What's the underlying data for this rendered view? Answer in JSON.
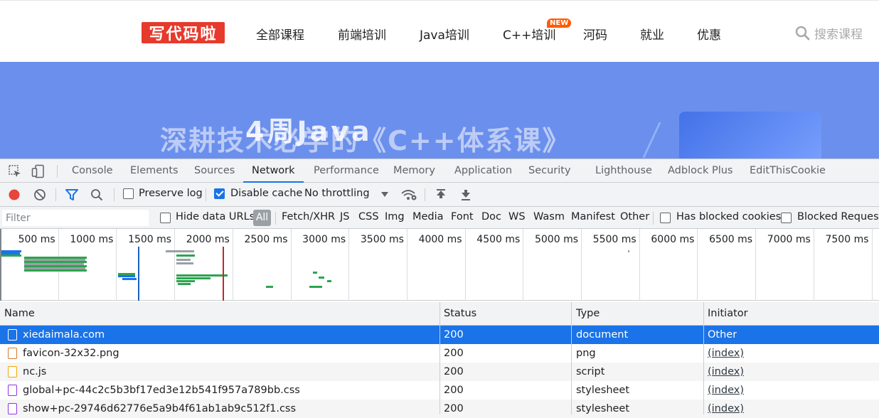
{
  "site": {
    "logo_text": "写代码啦",
    "nav": [
      "全部课程",
      "前端培训",
      "Java培训",
      "C++培训",
      "河码",
      "就业",
      "优惠"
    ],
    "new_badge": "NEW",
    "search_text": "搜索课程"
  },
  "banner": {
    "ghost_text": "4周Java",
    "title": "深耕技术必学的《C++体系课》",
    "background": "#6b8fec"
  },
  "devtools": {
    "tabs": [
      "Console",
      "Elements",
      "Sources",
      "Network",
      "Performance",
      "Memory",
      "Application",
      "Security",
      "Lighthouse",
      "Adblock Plus",
      "EditThisCookie"
    ],
    "active_tab": "Network",
    "toolbar": {
      "preserve_log_label": "Preserve log",
      "preserve_log_checked": false,
      "disable_cache_label": "Disable cache",
      "disable_cache_checked": true,
      "throttling_value": "No throttling"
    },
    "filter": {
      "placeholder": "Filter",
      "hide_data_urls_label": "Hide data URLs",
      "all_label": "All",
      "types": [
        "Fetch/XHR",
        "JS",
        "CSS",
        "Img",
        "Media",
        "Font",
        "Doc",
        "WS",
        "Wasm",
        "Manifest",
        "Other"
      ],
      "has_blocked_cookies_label": "Has blocked cookies",
      "blocked_requests_label": "Blocked Requests"
    },
    "timeline_ticks": [
      "500 ms",
      "1000 ms",
      "1500 ms",
      "2000 ms",
      "2500 ms",
      "3000 ms",
      "3500 ms",
      "4000 ms",
      "4500 ms",
      "5000 ms",
      "5500 ms",
      "6000 ms",
      "6500 ms",
      "7000 ms",
      "7500 ms"
    ],
    "columns": [
      "Name",
      "Status",
      "Type",
      "Initiator"
    ],
    "requests": [
      {
        "name": "xiedaimala.com",
        "status": "200",
        "type": "document",
        "initiator": "Other",
        "icon": "document-icon",
        "selected": true
      },
      {
        "name": "favicon-32x32.png",
        "status": "200",
        "type": "png",
        "initiator": "(index)",
        "icon": "image-icon",
        "selected": false
      },
      {
        "name": "nc.js",
        "status": "200",
        "type": "script",
        "initiator": "(index)",
        "icon": "script-icon",
        "selected": false
      },
      {
        "name": "global+pc-44c2c5b3bf17ed3e12b541f957a789bb.css",
        "status": "200",
        "type": "stylesheet",
        "initiator": "(index)",
        "icon": "stylesheet-icon",
        "selected": false
      },
      {
        "name": "show+pc-29746d62776e5a9b4f61ab1ab9c512f1.css",
        "status": "200",
        "type": "stylesheet",
        "initiator": "(index)",
        "icon": "stylesheet-icon",
        "selected": false
      }
    ],
    "colors": {
      "accent": "#1a73e8",
      "record": "#e8453c",
      "dom_content_loaded_line": "#1a62c4",
      "load_line": "#c2272d"
    }
  }
}
